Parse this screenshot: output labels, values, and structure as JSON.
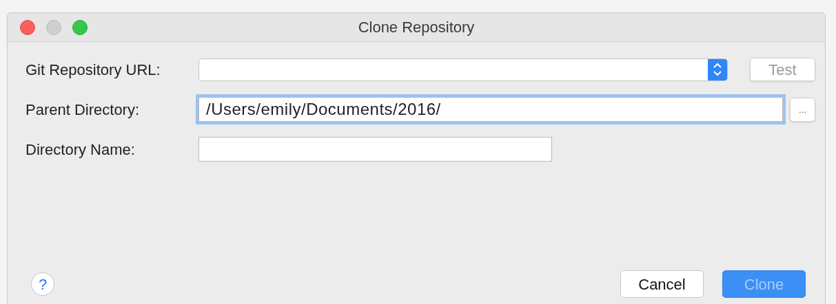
{
  "window": {
    "title": "Clone Repository"
  },
  "fields": [
    {
      "kind": "combo",
      "label": "Git Repository URL:",
      "button": {
        "label": "Test",
        "disabled": true
      },
      "focused": false
    },
    {
      "kind": "browse",
      "label": "Parent Directory:",
      "value": "/Users/emily/Documents/2016/",
      "button": {
        "label": "...",
        "disabled": false
      },
      "focused": true
    },
    {
      "kind": "text",
      "label": "Directory Name:",
      "focused": false
    }
  ],
  "help": {
    "label": "?"
  },
  "buttons": [
    {
      "label": "Cancel",
      "kind": "normal",
      "disabled": false
    },
    {
      "label": "Clone",
      "kind": "default",
      "disabled": true
    }
  ]
}
